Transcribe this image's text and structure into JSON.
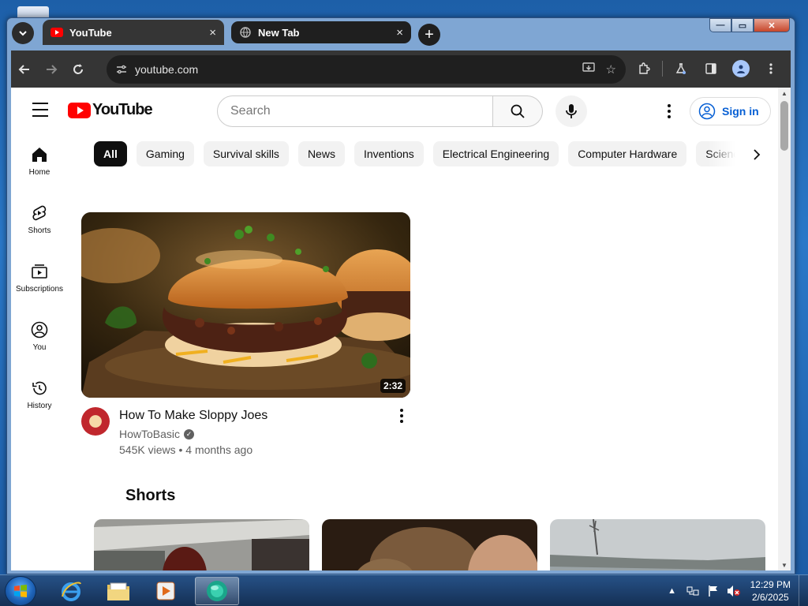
{
  "browser": {
    "tabs": [
      {
        "title": "YouTube",
        "active": true
      },
      {
        "title": "New Tab",
        "active": false
      }
    ],
    "new_tab_symbol": "+",
    "close_symbol": "×",
    "url": "youtube.com"
  },
  "youtube": {
    "search": {
      "placeholder": "Search"
    },
    "sign_in_label": "Sign in",
    "sidenav": [
      {
        "label": "Home",
        "icon": "home-icon"
      },
      {
        "label": "Shorts",
        "icon": "shorts-icon"
      },
      {
        "label": "Subscriptions",
        "icon": "subscriptions-icon"
      },
      {
        "label": "You",
        "icon": "you-icon"
      },
      {
        "label": "History",
        "icon": "history-icon"
      }
    ],
    "chips": [
      "All",
      "Gaming",
      "Survival skills",
      "News",
      "Inventions",
      "Electrical Engineering",
      "Computer Hardware",
      "Science"
    ],
    "video": {
      "title": "How To Make Sloppy Joes",
      "channel": "HowToBasic",
      "stats": "545K views • 4 months ago",
      "duration": "2:32"
    },
    "shorts_heading": "Shorts",
    "colors": {
      "brand_red": "#ff0000",
      "link_blue": "#065fd4",
      "text": "#0f0f0f",
      "secondary": "#606060"
    }
  },
  "taskbar": {
    "time": "12:29 PM",
    "date": "2/6/2025"
  }
}
